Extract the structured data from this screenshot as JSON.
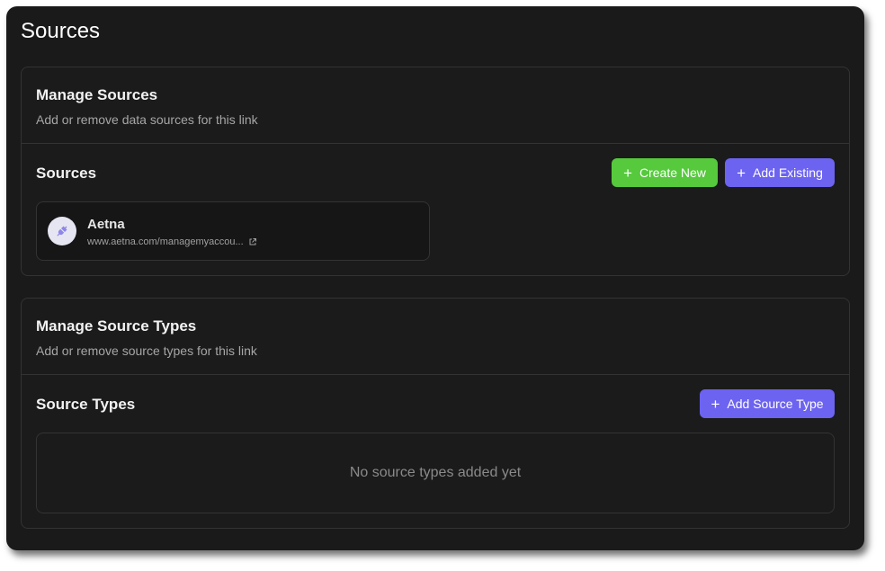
{
  "page": {
    "title": "Sources"
  },
  "manage_sources": {
    "title": "Manage Sources",
    "description": "Add or remove data sources for this link",
    "section_title": "Sources",
    "create_new_label": "Create New",
    "add_existing_label": "Add Existing",
    "items": [
      {
        "name": "Aetna",
        "url": "www.aetna.com/managemyaccou...",
        "icon": "plug-icon"
      }
    ]
  },
  "manage_source_types": {
    "title": "Manage Source Types",
    "description": "Add or remove source types for this link",
    "section_title": "Source Types",
    "add_label": "Add Source Type",
    "empty_text": "No source types added yet"
  },
  "colors": {
    "background": "#1a1a1a",
    "green": "#56c93d",
    "purple": "#6c63f0",
    "border": "#333333"
  }
}
